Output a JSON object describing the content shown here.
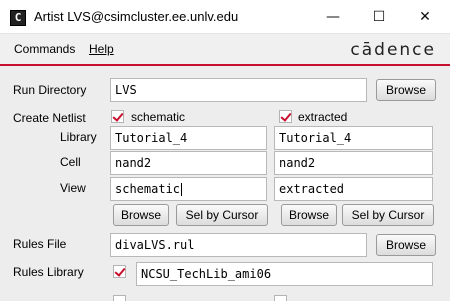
{
  "window": {
    "icon_glyph": "C",
    "title": "Artist LVS@csimcluster.ee.unlv.edu",
    "minimize_glyph": "—",
    "maximize_glyph": "☐",
    "close_glyph": "✕"
  },
  "menu": {
    "commands": "Commands",
    "help": "Help",
    "logo": "cādence"
  },
  "form": {
    "run_directory": {
      "label": "Run Directory",
      "value": "LVS",
      "browse": "Browse"
    },
    "create_netlist": {
      "label": "Create Netlist",
      "schematic": {
        "checked": true,
        "label": "schematic",
        "library": "Tutorial_4",
        "cell": "nand2",
        "view": "schematic"
      },
      "extracted": {
        "checked": true,
        "label": "extracted",
        "library": "Tutorial_4",
        "cell": "nand2",
        "view": "extracted"
      },
      "library_label": "Library",
      "cell_label": "Cell",
      "view_label": "View",
      "browse": "Browse",
      "sel_by_cursor": "Sel by Cursor"
    },
    "rules_file": {
      "label": "Rules File",
      "value": "divaLVS.rul",
      "browse": "Browse"
    },
    "rules_library": {
      "label": "Rules Library",
      "checked": true,
      "value": "NCSU_TechLib_ami06"
    }
  },
  "colors": {
    "accent": "#c8102e",
    "form_bg": "#ededed",
    "menu_bg": "#f0f0f0"
  }
}
